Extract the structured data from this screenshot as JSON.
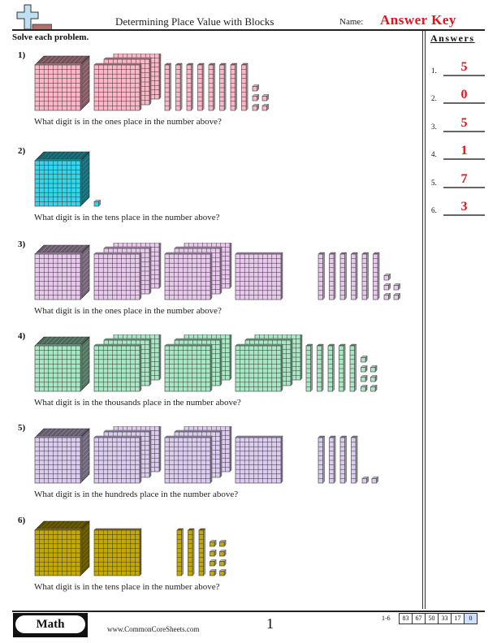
{
  "header": {
    "title": "Determining Place Value with Blocks",
    "name_label": "Name:",
    "answer_key": "Answer Key",
    "instructions": "Solve each problem."
  },
  "answers_panel": {
    "heading": "Answers",
    "items": [
      {
        "num": "1.",
        "value": "5"
      },
      {
        "num": "2.",
        "value": "0"
      },
      {
        "num": "3.",
        "value": "5"
      },
      {
        "num": "4.",
        "value": "1"
      },
      {
        "num": "5.",
        "value": "7"
      },
      {
        "num": "6.",
        "value": "3"
      }
    ]
  },
  "problems": [
    {
      "label": "1)",
      "question": "What digit is in the ones place in the number above?",
      "color": "#ffb6c8",
      "thousands": 1,
      "hundreds": 3,
      "tens": 8,
      "ones": 5
    },
    {
      "label": "2)",
      "question": "What digit is in the tens place in the number above?",
      "color": "#33d6ea",
      "thousands": 1,
      "hundreds": 0,
      "tens": 0,
      "ones": 1
    },
    {
      "label": "3)",
      "question": "What digit is in the ones place in the number above?",
      "color": "#e9c8ee",
      "thousands": 1,
      "hundreds": 7,
      "tens": 6,
      "ones": 5
    },
    {
      "label": "4)",
      "question": "What digit is in the thousands place in the number above?",
      "color": "#a8e8c4",
      "thousands": 1,
      "hundreds": 9,
      "tens": 5,
      "ones": 7
    },
    {
      "label": "5)",
      "question": "What digit is in the hundreds place in the number above?",
      "color": "#dcccf0",
      "thousands": 1,
      "hundreds": 7,
      "tens": 4,
      "ones": 2
    },
    {
      "label": "6)",
      "question": "What digit is in the tens place in the number above?",
      "color": "#c4aa00",
      "thousands": 1,
      "hundreds": 1,
      "tens": 3,
      "ones": 8
    }
  ],
  "footer": {
    "badge": "Math",
    "site": "www.CommonCoreSheets.com",
    "page": "1",
    "range": "1-6",
    "scores": [
      "83",
      "67",
      "50",
      "33",
      "17",
      "0"
    ]
  }
}
